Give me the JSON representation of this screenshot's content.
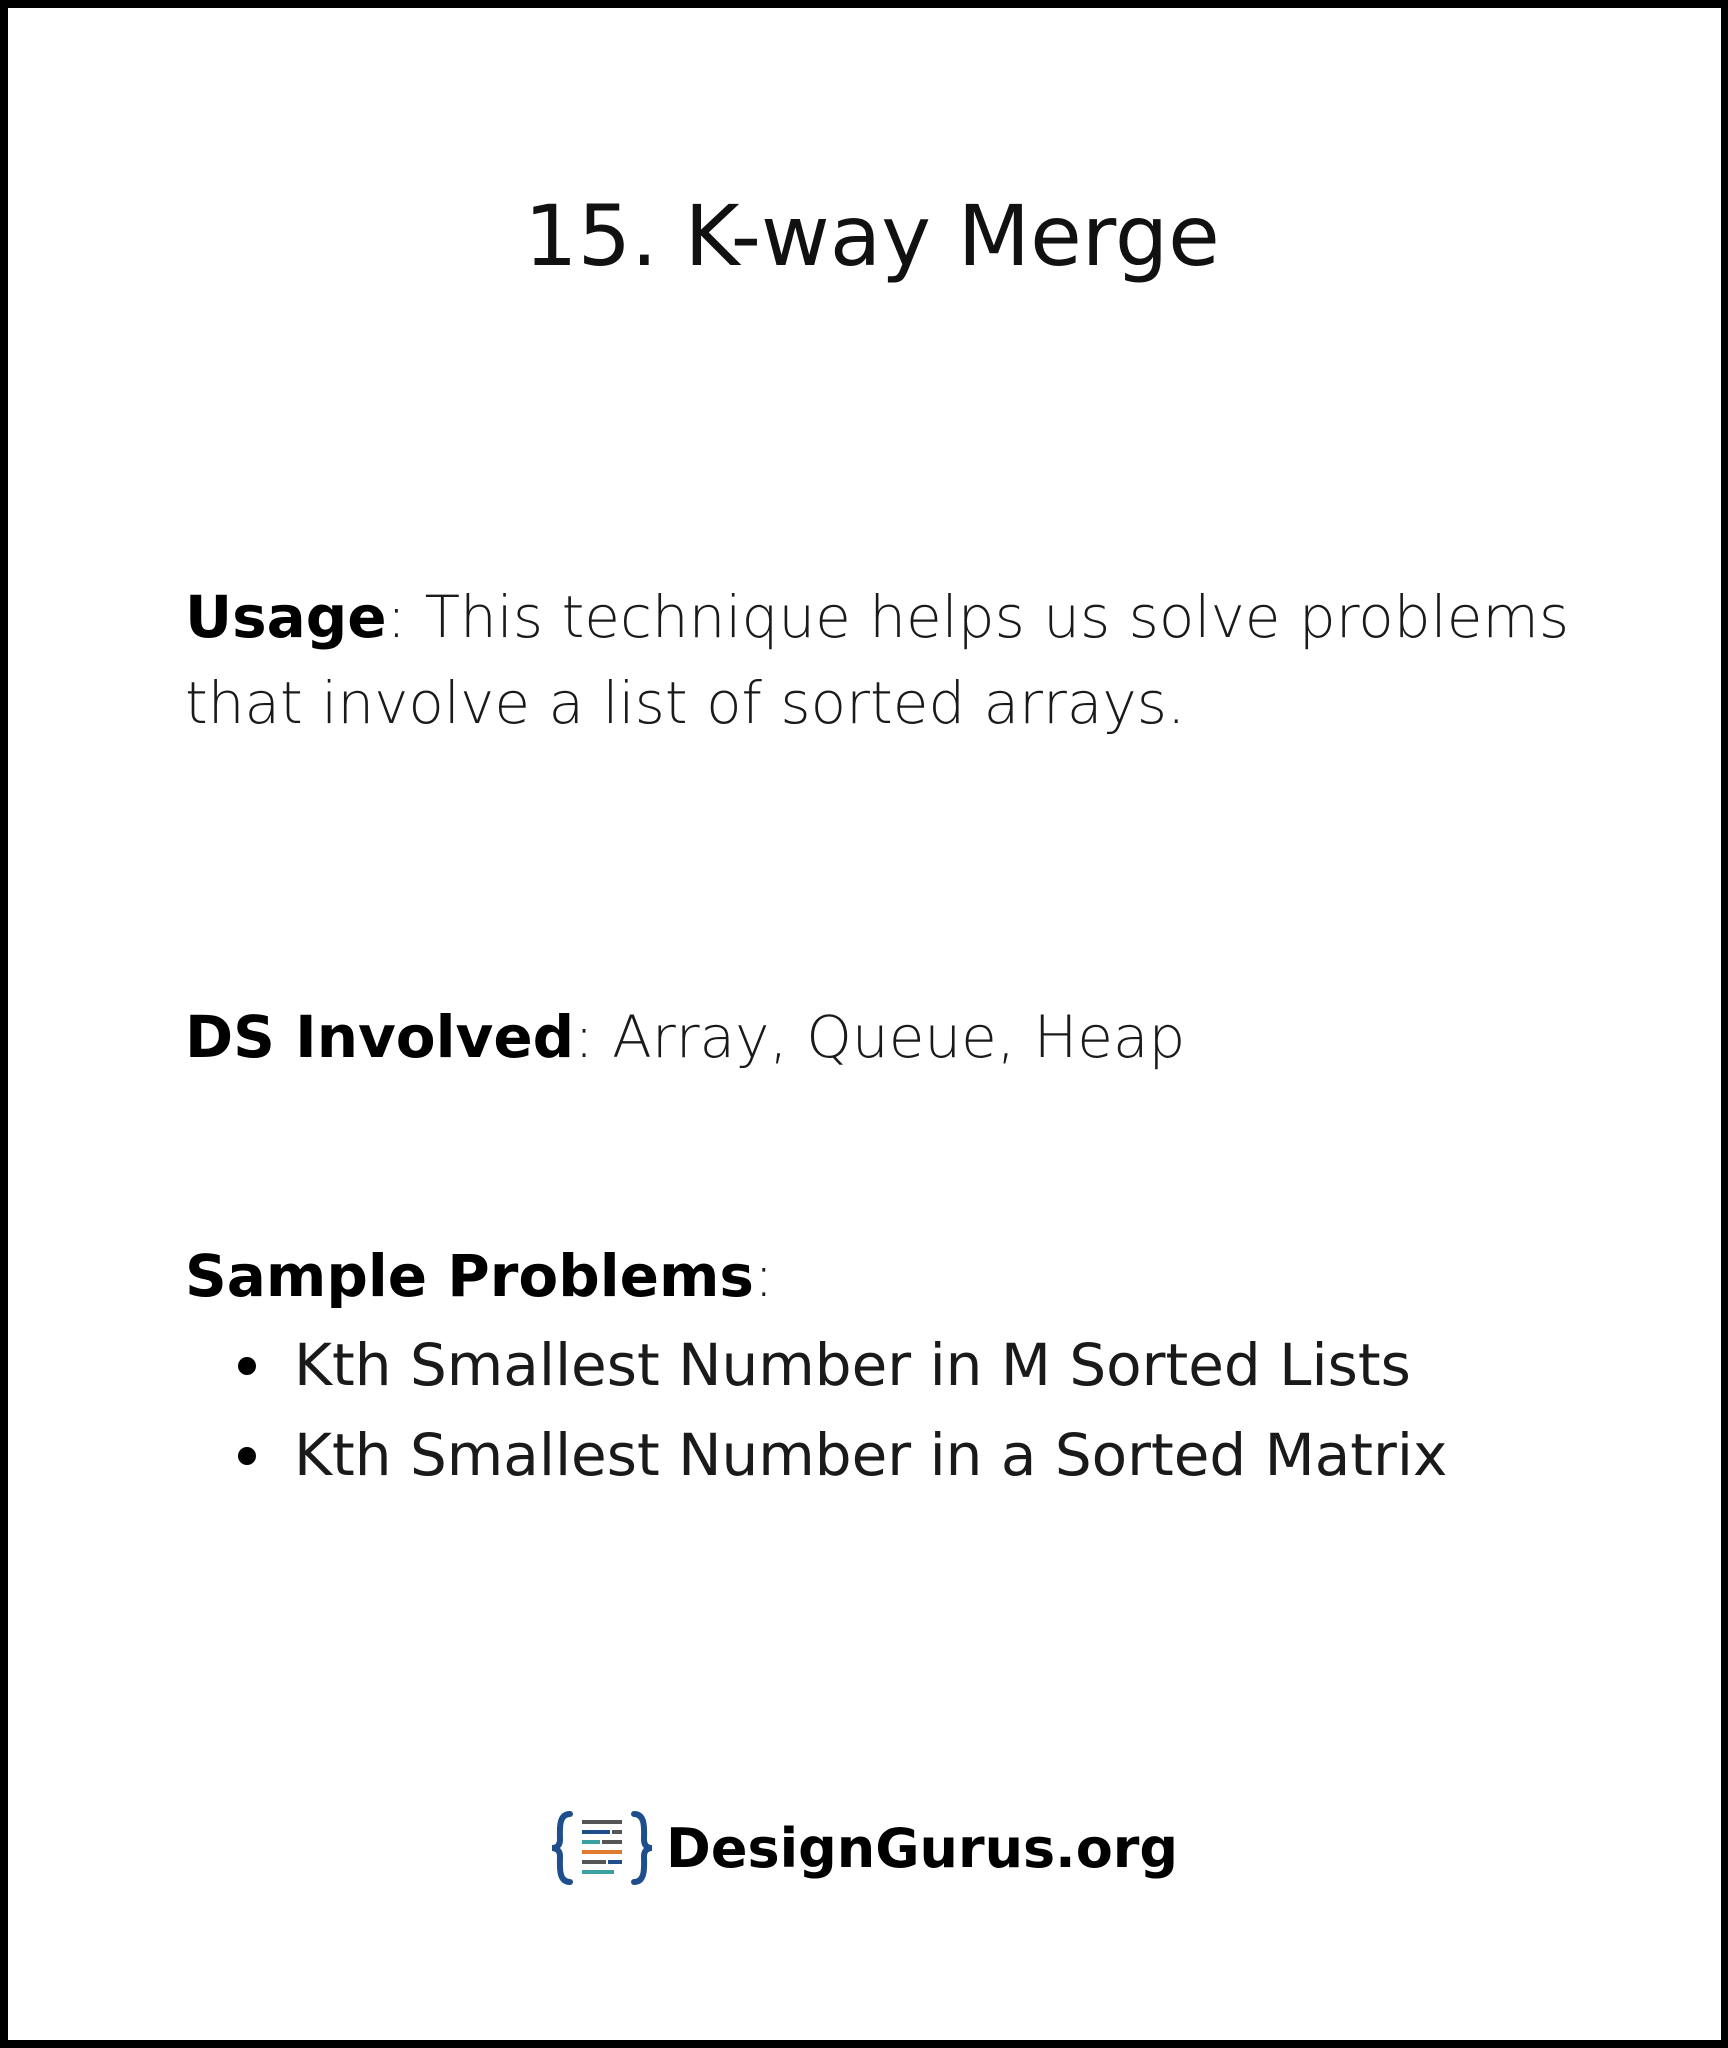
{
  "title": "15. K-way Merge",
  "usage": {
    "label": "Usage",
    "separator": ":",
    "text": " This technique helps us solve problems that involve a list of sorted arrays."
  },
  "ds_involved": {
    "label": "DS Involved",
    "separator": ":",
    "text": " Array, Queue, Heap"
  },
  "sample_problems": {
    "label": "Sample Problems",
    "separator": ":",
    "items": [
      "Kth Smallest Number in M Sorted Lists",
      "Kth Smallest Number in a Sorted Matrix"
    ]
  },
  "brand": {
    "name": "DesignGurus.org",
    "logo_icon": "code-braces-icon",
    "logo_colors": [
      "#1f4e8c",
      "#e07a2e",
      "#3aa0a0"
    ]
  }
}
